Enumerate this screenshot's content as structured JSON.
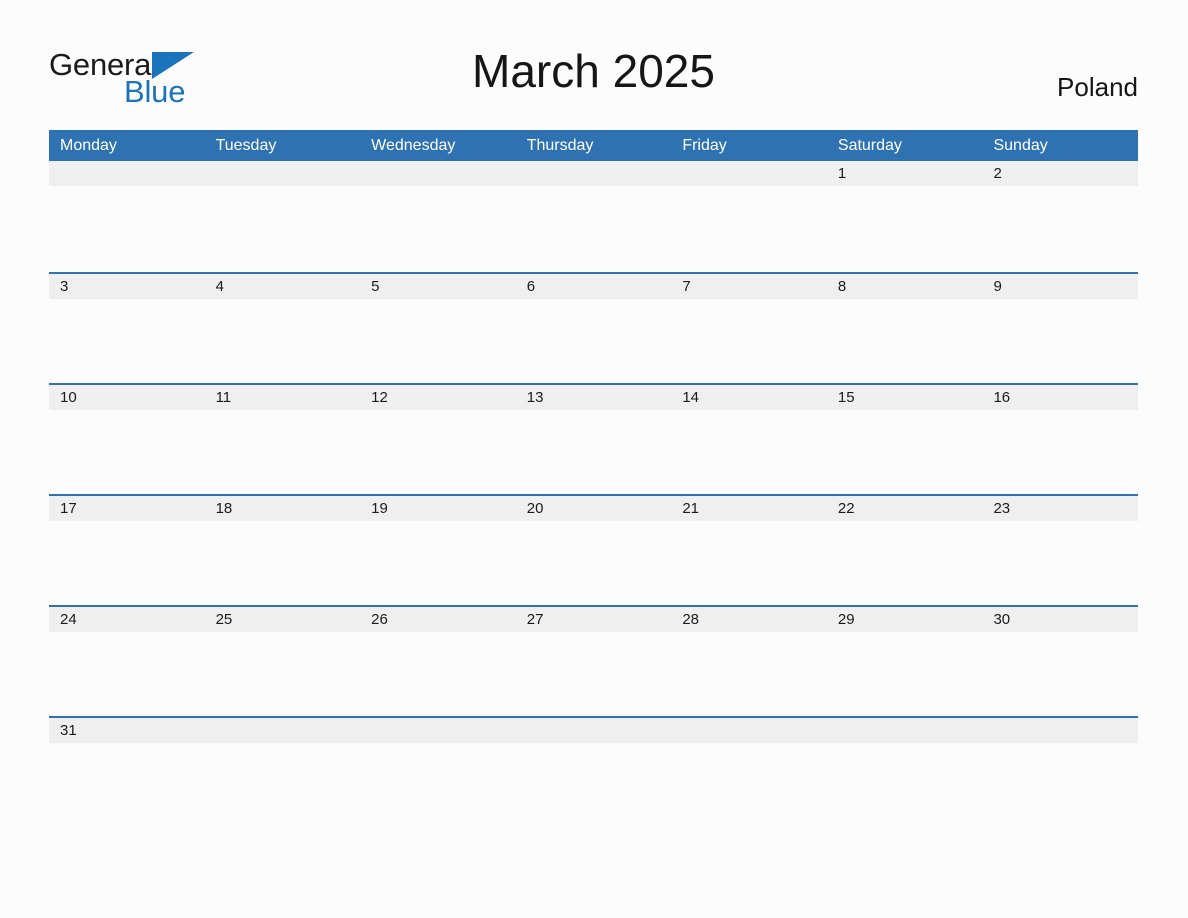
{
  "brand": {
    "name_part1": "General",
    "name_part2": "Blue",
    "triangle_color": "#1b74bb"
  },
  "header": {
    "title": "March 2025",
    "country": "Poland"
  },
  "colors": {
    "header_blue": "#2e72b2",
    "rule_blue": "#2e72b2",
    "date_strip_gray": "#efefef",
    "page_background": "#fcfcfc",
    "text_dark": "#1b1b1b",
    "weekday_text": "#ffffff"
  },
  "calendar": {
    "month": "March",
    "year": "2025",
    "weekday_headers": [
      "Monday",
      "Tuesday",
      "Wednesday",
      "Thursday",
      "Friday",
      "Saturday",
      "Sunday"
    ],
    "weeks": [
      {
        "days": [
          "",
          "",
          "",
          "",
          "",
          "1",
          "2"
        ]
      },
      {
        "days": [
          "3",
          "4",
          "5",
          "6",
          "7",
          "8",
          "9"
        ]
      },
      {
        "days": [
          "10",
          "11",
          "12",
          "13",
          "14",
          "15",
          "16"
        ]
      },
      {
        "days": [
          "17",
          "18",
          "19",
          "20",
          "21",
          "22",
          "23"
        ]
      },
      {
        "days": [
          "24",
          "25",
          "26",
          "27",
          "28",
          "29",
          "30"
        ]
      },
      {
        "days": [
          "31",
          "",
          "",
          "",
          "",
          "",
          ""
        ]
      }
    ]
  }
}
